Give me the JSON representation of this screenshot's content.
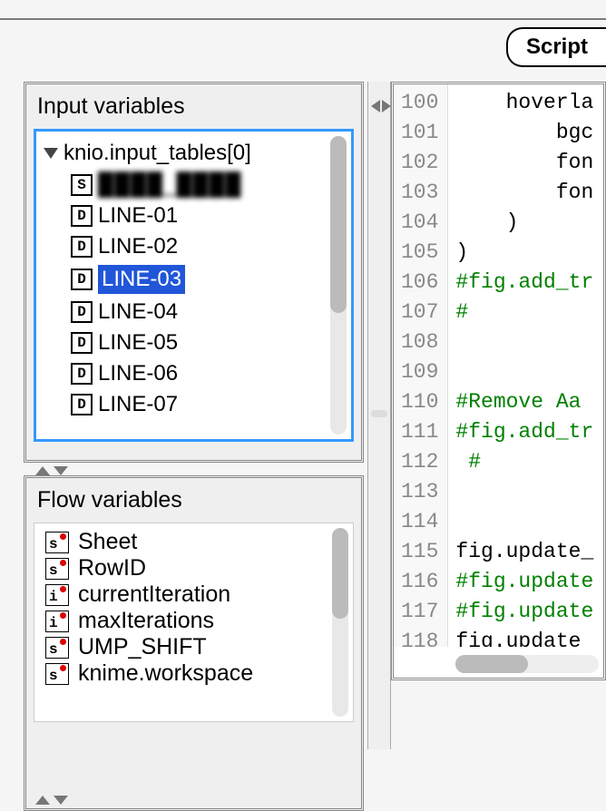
{
  "tab": {
    "label": "Script"
  },
  "input_variables": {
    "title": "Input variables",
    "root": "knio.input_tables[0]",
    "columns": [
      {
        "type": "S",
        "name": "████_████"
      },
      {
        "type": "D",
        "name": "LINE-01"
      },
      {
        "type": "D",
        "name": "LINE-02"
      },
      {
        "type": "D",
        "name": "LINE-03",
        "selected": true
      },
      {
        "type": "D",
        "name": "LINE-04"
      },
      {
        "type": "D",
        "name": "LINE-05"
      },
      {
        "type": "D",
        "name": "LINE-06"
      },
      {
        "type": "D",
        "name": "LINE-07"
      }
    ]
  },
  "flow_variables": {
    "title": "Flow variables",
    "items": [
      {
        "type": "s",
        "name": "Sheet"
      },
      {
        "type": "s",
        "name": "RowID"
      },
      {
        "type": "i",
        "name": "currentIteration"
      },
      {
        "type": "i",
        "name": "maxIterations"
      },
      {
        "type": "s",
        "name": "UMP_SHIFT"
      },
      {
        "type": "s",
        "name": "knime.workspace"
      }
    ]
  },
  "editor": {
    "first_line": 100,
    "lines": [
      {
        "num": 100,
        "text": "    hoverla",
        "cls": "t-normal"
      },
      {
        "num": 101,
        "text": "        bgc",
        "cls": "t-normal"
      },
      {
        "num": 102,
        "text": "        fon",
        "cls": "t-normal"
      },
      {
        "num": 103,
        "text": "        fon",
        "cls": "t-normal"
      },
      {
        "num": 104,
        "text": "    )",
        "cls": "t-normal"
      },
      {
        "num": 105,
        "text": ")",
        "cls": "t-normal"
      },
      {
        "num": 106,
        "text": "#fig.add_tr",
        "cls": "t-comment"
      },
      {
        "num": 107,
        "text": "#",
        "cls": "t-comment"
      },
      {
        "num": 108,
        "text": "",
        "cls": "t-normal"
      },
      {
        "num": 109,
        "text": "",
        "cls": "t-normal"
      },
      {
        "num": 110,
        "text": "#Remove Aa ",
        "cls": "t-comment"
      },
      {
        "num": 111,
        "text": "#fig.add_tr",
        "cls": "t-comment"
      },
      {
        "num": 112,
        "text": " #",
        "cls": "t-comment"
      },
      {
        "num": 113,
        "text": "",
        "cls": "t-normal"
      },
      {
        "num": 114,
        "text": "",
        "cls": "t-normal"
      },
      {
        "num": 115,
        "text": "fig.update_",
        "cls": "t-normal"
      },
      {
        "num": 116,
        "text": "#fig.update",
        "cls": "t-comment"
      },
      {
        "num": 117,
        "text": "#fig.update",
        "cls": "t-comment"
      },
      {
        "num": 118,
        "text": "fig.update_",
        "cls": "t-normal"
      }
    ]
  }
}
